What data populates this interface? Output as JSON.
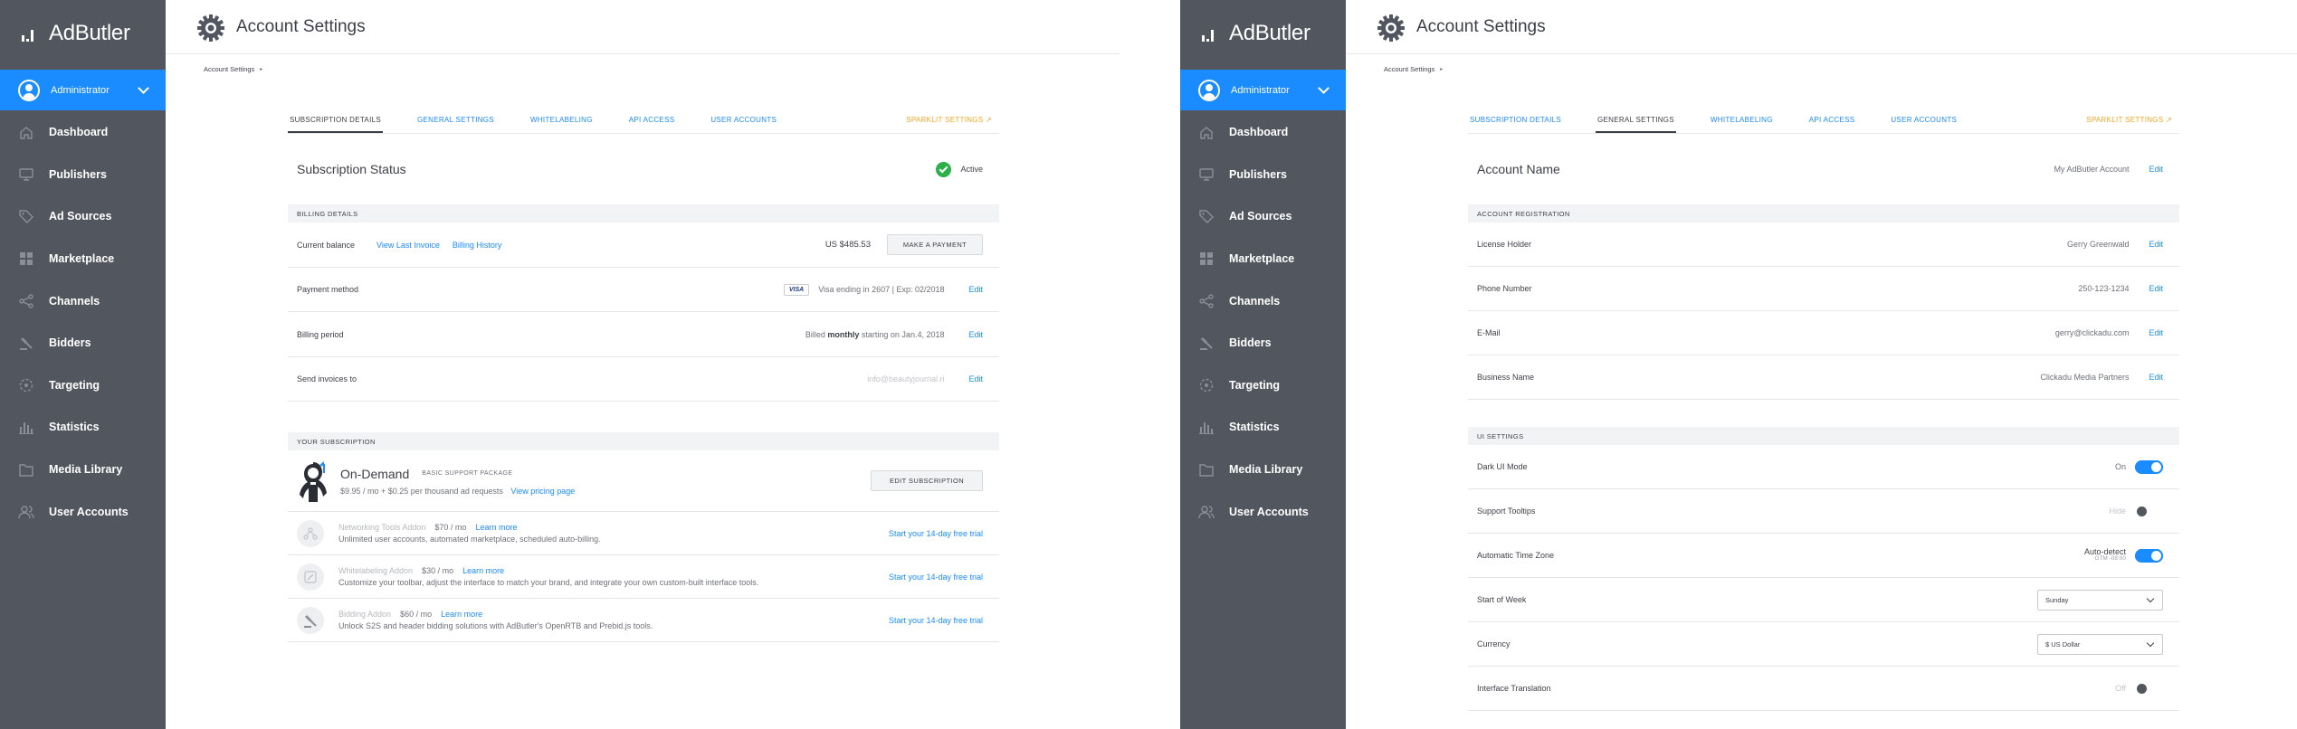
{
  "sidebar": {
    "brand": "AdButler",
    "admin": "Administrator",
    "items": [
      {
        "label": "Dashboard",
        "icon": "home-icon"
      },
      {
        "label": "Publishers",
        "icon": "monitor-icon"
      },
      {
        "label": "Ad Sources",
        "icon": "tag-icon"
      },
      {
        "label": "Marketplace",
        "icon": "grid-icon"
      },
      {
        "label": "Channels",
        "icon": "share-icon"
      },
      {
        "label": "Bidders",
        "icon": "gavel-icon"
      },
      {
        "label": "Targeting",
        "icon": "target-icon"
      },
      {
        "label": "Statistics",
        "icon": "bar-chart-icon"
      },
      {
        "label": "Media Library",
        "icon": "folder-icon"
      },
      {
        "label": "User Accounts",
        "icon": "users-icon"
      }
    ]
  },
  "header": {
    "title": "Account Settings"
  },
  "breadcrumb": {
    "label": "Account Settings",
    "arrow": "▸"
  },
  "tabs": {
    "subscription": "SUBSCRIPTION DETAILS",
    "general": "GENERAL SETTINGS",
    "whitelabeling": "WHITELABELING",
    "api": "API ACCESS",
    "users": "USER ACCOUNTS",
    "sparklit": "SPARKLIT SETTINGS ↗"
  },
  "subscription": {
    "status_title": "Subscription Status",
    "status_value": "Active",
    "billing_head": "BILLING DETAILS",
    "balance_label": "Current balance",
    "view_invoice": "View Last Invoice",
    "billing_history": "Billing History",
    "balance_value": "US $485.53",
    "make_payment": "MAKE A PAYMENT",
    "payment_label": "Payment method",
    "card_brand": "VISA",
    "card_text": "Visa ending in 2607 | Exp: 02/2018",
    "edit": "Edit",
    "period_label": "Billing period",
    "period_pre": "Billed ",
    "period_bold": "monthly",
    "period_post": " starting on Jan.4, 2018",
    "invoices_label": "Send invoices to",
    "invoices_value": "info@beautyjournal.ri",
    "your_sub_head": "YOUR SUBSCRIPTION",
    "plan_name": "On-Demand",
    "plan_package": "BASIC SUPPORT PACKAGE",
    "plan_price": "$9.95 / mo + $0.25 per thousand ad requests",
    "view_pricing": "View pricing page",
    "edit_subscription": "EDIT SUBSCRIPTION",
    "addons": [
      {
        "name": "Networking Tools Addon",
        "price": "$70 / mo",
        "learn": "Learn more",
        "desc": "Unlimited user accounts, automated marketplace, scheduled auto-billing.",
        "cta": "Start your 14-day free trial",
        "icon": "network-icon"
      },
      {
        "name": "Whitelabeling Addon",
        "price": "$30 / mo",
        "learn": "Learn more",
        "desc": "Customize your toolbar, adjust the interface to match your brand, and integrate your own custom-built interface tools.",
        "cta": "Start your 14-day free trial",
        "icon": "paint-icon"
      },
      {
        "name": "Bidding Addon",
        "price": "$60 / mo",
        "learn": "Learn more",
        "desc": "Unlock S2S and header bidding solutions with AdButler's OpenRTB and Prebid.js tools.",
        "cta": "Start your 14-day free trial",
        "icon": "gavel-icon"
      }
    ]
  },
  "general": {
    "account_name_label": "Account Name",
    "account_name_value": "My AdButler Account",
    "edit": "Edit",
    "registration_head": "ACCOUNT REGISTRATION",
    "registration": [
      {
        "label": "License Holder",
        "value": "Gerry Greenwald"
      },
      {
        "label": "Phone Number",
        "value": "250-123-1234"
      },
      {
        "label": "E-Mail",
        "value": "gerry@clickadu.com"
      },
      {
        "label": "Business Name",
        "value": "Clickadu Media Partners"
      }
    ],
    "ui_head": "UI SETTINGS",
    "dark_mode_label": "Dark UI Mode",
    "dark_mode_value": "On",
    "tooltips_label": "Support Tooltips",
    "tooltips_value": "Hide",
    "timezone_label": "Automatic Time Zone",
    "timezone_value": "Auto-detect",
    "timezone_sub": "GTM -08:00",
    "week_label": "Start of Week",
    "week_value": "Sunday",
    "currency_label": "Currency",
    "currency_value": "$ US Dollar",
    "translation_label": "Interface Translation",
    "translation_value": "Off"
  },
  "colors": {
    "accent": "#1a8cff",
    "sidebar": "#52565e",
    "sparklit": "#f5a623",
    "success": "#2bb04a"
  }
}
